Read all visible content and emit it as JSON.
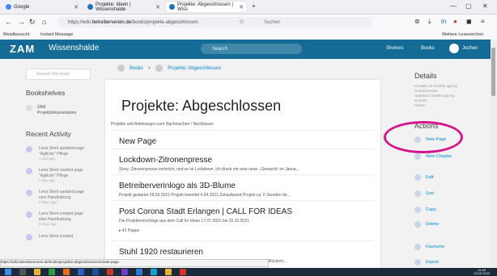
{
  "browser": {
    "tabs": [
      {
        "label": "Google",
        "active": false,
        "color": "#4285f4"
      },
      {
        "label": "Projekte: Ideen | Wissenshalde",
        "active": false,
        "color": "#1a74bf"
      },
      {
        "label": "Projekte: Abgeschlossen | Wiss",
        "active": true,
        "color": "#1a74bf"
      }
    ],
    "url_prefix": "https://wiki.",
    "url_domain": "betreiberverein.de",
    "url_path": "/books/projekte-abgeschlossen",
    "search_placeholder": "Suchen",
    "bookmarks": [
      "Meistbesucht",
      "Instant Message"
    ],
    "other_bookmarks": "Weitere Lesezeichen"
  },
  "app": {
    "logo": "ZAM",
    "site_name": "Wissenshalde",
    "search_placeholder": "Search",
    "shelves": "Shelves",
    "books": "Books",
    "user": "Jochen",
    "brand_color": "#136b96"
  },
  "left_sidebar": {
    "search_placeholder": "Search this book",
    "bookshelves_heading": "Bookshelves",
    "shelves": [
      {
        "line1": "ZAM",
        "line2": "Projektdokumentation"
      }
    ],
    "recent_heading": "Recent Activity",
    "activity": [
      {
        "text1": "Lena Streit updated page",
        "text2": "\"Agilicke\" Pflege",
        "time": "1 day ago"
      },
      {
        "text1": "Lena Streit created page",
        "text2": "\"Agilicke\" Pflege",
        "time": "1 day ago"
      },
      {
        "text1": "Lena Streit updated page",
        "text2": "eine Handhabung",
        "time": "2 days ago"
      },
      {
        "text1": "Lena Streit created page",
        "text2": "eine Handhabung",
        "time": "2 days ago"
      },
      {
        "text1": "Lena Streit created",
        "text2": "",
        "time": ""
      }
    ]
  },
  "breadcrumb": {
    "books": "Books",
    "separator": ">",
    "current": "Projekte: Abgeschlossen"
  },
  "book": {
    "title": "Projekte: Abgeschlossen",
    "description": "Projekte und Anleitungen zum Nachmachen / Nachbauen",
    "entries": [
      {
        "title": "New Page",
        "desc": ""
      },
      {
        "title": "Lockdown-Zitronenpresse",
        "desc": "Story: Zitronenpresse zerbricht, und es ist Lockdown. Ich druck mir eine neue...Gemacht: im Janua..."
      },
      {
        "title": "Betreiberverinlogo als 3D-Blume",
        "desc": "Projekt gestartet 28.03.2021 Projekt beendet 4.04.2021 Zeitaufwand Projekt ca. 6 Stunden für..."
      },
      {
        "title": "Post Corona Stadt Erlangen | CALL FOR IDEAS",
        "desc": "Die Projektvorschläge aus dem Call for Ideas 17.07.2021 bis 15.10.2021",
        "pages": "41 Pages"
      },
      {
        "title": "Stuhl 1920 restaurieren",
        "desc": "DEGENSTAND Stuhl ca 1920: jahre mit neu/Moraser Rohrgeflecht Sitzfläche und - Rückenl..."
      }
    ]
  },
  "right_sidebar": {
    "details_heading": "Details",
    "details": [
      "Created 10 months ago by",
      "Conrad Hesse",
      "Updated 3 weeks ago by Conrad",
      "Hesse"
    ],
    "actions_heading": "Actions",
    "actions": [
      "New Page",
      "New Chapter",
      "Edit",
      "Sort",
      "Copy",
      "Delete",
      "Favourite",
      "Export"
    ],
    "annotation_color": "#d4148c"
  },
  "statusbar": {
    "url": "https://wiki.betreiberverein.de/books/projekte-abgeschlossen/create-page"
  },
  "taskbar": {
    "time": "11:18",
    "date": "13.02.2022"
  }
}
